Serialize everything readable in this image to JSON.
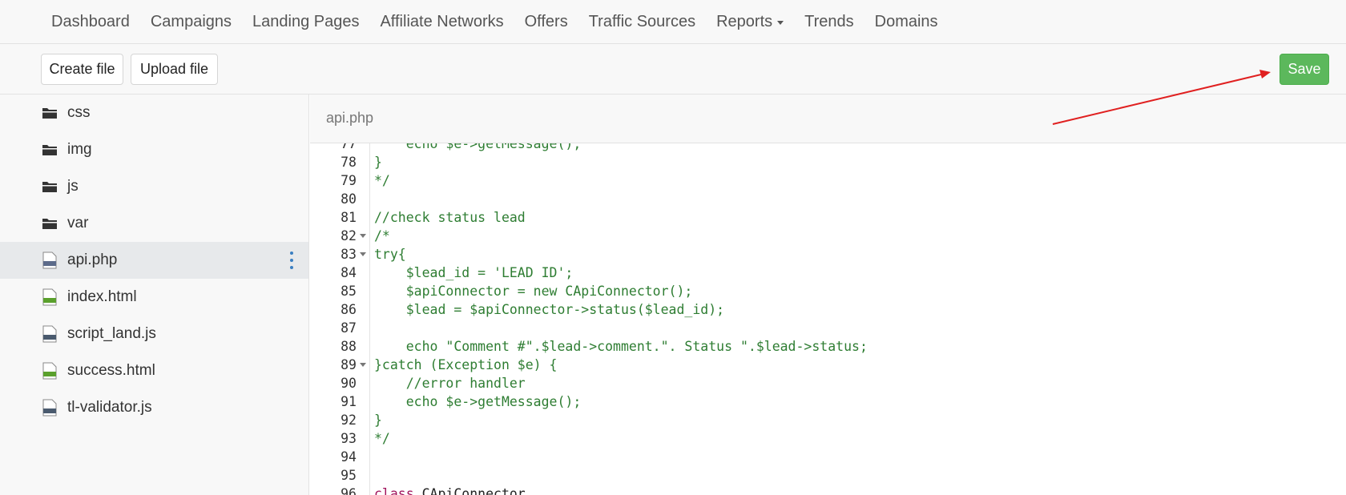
{
  "nav": {
    "items": [
      {
        "label": "Dashboard"
      },
      {
        "label": "Campaigns"
      },
      {
        "label": "Landing Pages"
      },
      {
        "label": "Affiliate Networks"
      },
      {
        "label": "Offers"
      },
      {
        "label": "Traffic Sources"
      },
      {
        "label": "Reports",
        "dropdown": true
      },
      {
        "label": "Trends"
      },
      {
        "label": "Domains"
      }
    ]
  },
  "toolbar": {
    "create_label": "Create file",
    "upload_label": "Upload file",
    "save_label": "Save"
  },
  "sidebar": {
    "files": [
      {
        "name": "css",
        "type": "folder"
      },
      {
        "name": "img",
        "type": "folder"
      },
      {
        "name": "js",
        "type": "folder"
      },
      {
        "name": "var",
        "type": "folder"
      },
      {
        "name": "api.php",
        "type": "php",
        "active": true
      },
      {
        "name": "index.html",
        "type": "html"
      },
      {
        "name": "script_land.js",
        "type": "js"
      },
      {
        "name": "success.html",
        "type": "html"
      },
      {
        "name": "tl-validator.js",
        "type": "js"
      }
    ]
  },
  "editor": {
    "filename": "api.php",
    "lines": [
      {
        "num": "77",
        "text": "    echo $e->getMessage();"
      },
      {
        "num": "78",
        "text": "}"
      },
      {
        "num": "79",
        "text": "*/"
      },
      {
        "num": "80",
        "text": ""
      },
      {
        "num": "81",
        "text": "//check status lead"
      },
      {
        "num": "82",
        "text": "/*",
        "fold": true
      },
      {
        "num": "83",
        "text": "try{",
        "fold": true
      },
      {
        "num": "84",
        "text": "    $lead_id = 'LEAD ID';"
      },
      {
        "num": "85",
        "text": "    $apiConnector = new CApiConnector();"
      },
      {
        "num": "86",
        "text": "    $lead = $apiConnector->status($lead_id);"
      },
      {
        "num": "87",
        "text": ""
      },
      {
        "num": "88",
        "text": "    echo \"Comment #\".$lead->comment.\". Status \".$lead->status;"
      },
      {
        "num": "89",
        "text": "}catch (Exception $e) {",
        "fold": true
      },
      {
        "num": "90",
        "text": "    //error handler"
      },
      {
        "num": "91",
        "text": "    echo $e->getMessage();"
      },
      {
        "num": "92",
        "text": "}"
      },
      {
        "num": "93",
        "text": "*/"
      },
      {
        "num": "94",
        "text": ""
      },
      {
        "num": "95",
        "text": ""
      },
      {
        "num": "96",
        "text": "class CApiConnector",
        "kw": "class",
        "rest": " CApiConnector"
      }
    ]
  },
  "colors": {
    "save_button": "#5cb85c",
    "code_comment": "#2e7d32",
    "keyword": "#a0135c",
    "annotation_arrow": "#e02020"
  }
}
